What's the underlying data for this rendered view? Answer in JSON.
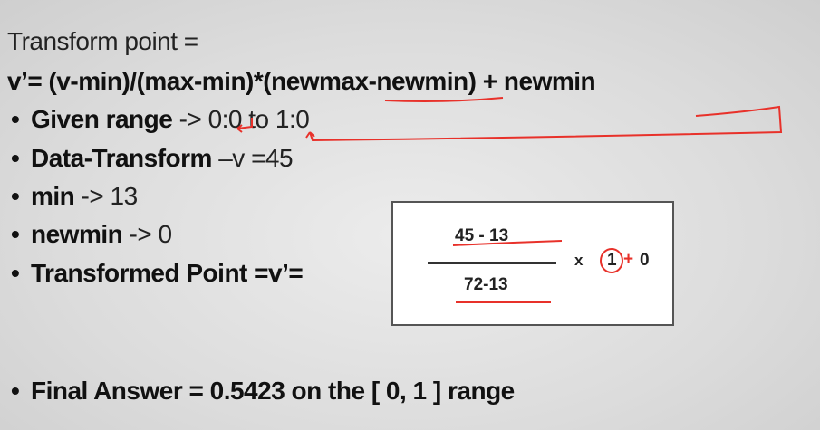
{
  "title": "Transform point  =",
  "formula": "v’= (v-min)/(max-min)*(newmax-newmin) + newmin",
  "bullets": [
    {
      "label": "Given range",
      "value": " -> 0:0 to 1:0"
    },
    {
      "label": "Data-Transform",
      "value": " –v =45"
    },
    {
      "label": "min",
      "value": " -> 13"
    },
    {
      "label": "newmin",
      "value": " -> 0"
    },
    {
      "label": "Transformed Point =v’=",
      "value": ""
    }
  ],
  "box": {
    "numerator": "45 - 13",
    "denominator": "72-13",
    "times": "x",
    "newmax": "1",
    "plus": "+",
    "newmin": "0"
  },
  "final": "Final Answer = 0.5423 on the [ 0, 1 ] range",
  "annotation_color": "#e8312a"
}
